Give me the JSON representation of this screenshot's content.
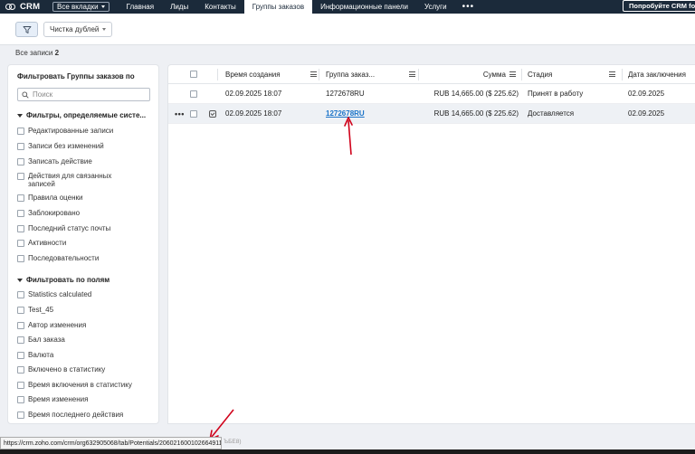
{
  "nav": {
    "app_name": "CRM",
    "all_tabs": "Все вкладки",
    "items": [
      "Главная",
      "Лиды",
      "Контакты",
      "Группы заказов",
      "Информационные панели",
      "Услуги"
    ],
    "more": "•••",
    "try_button": "Попробуйте CRM fo"
  },
  "toolbar": {
    "dedupe_label": "Чистка дублей"
  },
  "records": {
    "label": "Все записи",
    "count": "2"
  },
  "sidebar": {
    "title": "Фильтровать Группы заказов по",
    "search_placeholder": "Поиск",
    "system_section": "Фильтры, определяемые систе...",
    "system_filters": [
      "Редактированные записи",
      "Записи без изменений",
      "Записать действие",
      "Действия для связанных записей",
      "Правила оценки",
      "Заблокировано",
      "Последний статус почты",
      "Активности",
      "Последовательности"
    ],
    "field_section": "Фильтровать по полям",
    "field_filters": [
      "Statistics calculated",
      "Test_45",
      "Автор изменения",
      "Бал заказа",
      "Валюта",
      "Включено в статистику",
      "Время включения в статистику",
      "Время изменения",
      "Время последнего действия"
    ]
  },
  "table": {
    "columns": [
      "Время создания",
      "Группа заказ...",
      "Сумма",
      "Стадия",
      "Дата заключения"
    ],
    "rows": [
      {
        "created": "02.09.2025 18:07",
        "group": "1272678RU",
        "amount": "RUB 14,665.00 ($ 225.62)",
        "stage": "Принят в работу",
        "close_date": "02.09.2025"
      },
      {
        "created": "02.09.2025 18:07",
        "group": "1272678RU",
        "amount": "RUB 14,665.00 ($ 225.62)",
        "stage": "Доставляется",
        "close_date": "02.09.2025"
      }
    ]
  },
  "statusbar": {
    "url": "https://crm.zoho.com/crm/org632905068/tab/Potentials/2060216001026649118",
    "faint": "ЪБЕ8)"
  },
  "colors": {
    "nav_bg": "#1b2a3a",
    "link": "#1a73c8",
    "annotation": "#d0021b"
  }
}
